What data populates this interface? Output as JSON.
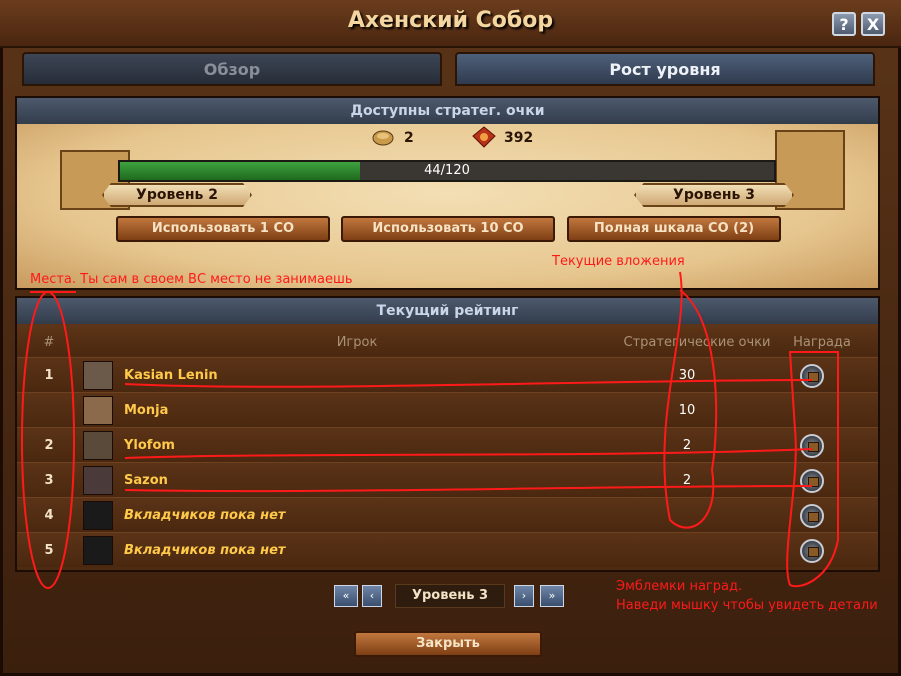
{
  "window": {
    "title": "Ахенский Собор",
    "help_label": "?",
    "close_label": "X"
  },
  "tabs": [
    {
      "label": "Обзор",
      "active": false
    },
    {
      "label": "Рост уровня",
      "active": true
    }
  ],
  "fp_section": {
    "header": "Доступны стратег. очки",
    "fp_count": "2",
    "goods_count": "392",
    "progress_text": "44/120",
    "progress_value": 0.367,
    "level_current": "Уровень 2",
    "level_next": "Уровень 3",
    "buttons": [
      "Использовать 1 СО",
      "Использовать 10 СО",
      "Полная шкала СО (2)"
    ]
  },
  "ranking": {
    "header": "Текущий рейтинг",
    "columns": {
      "rank": "#",
      "player": "Игрок",
      "points": "Стратегические очки",
      "reward": "Награда"
    },
    "rows": [
      {
        "rank": "1",
        "player": "Kasian Lenin",
        "points": "30",
        "reward": true,
        "avatar": "#6b5a4a"
      },
      {
        "rank": "",
        "player": "Monja",
        "points": "10",
        "reward": false,
        "avatar": "#8a6a4a"
      },
      {
        "rank": "2",
        "player": "Ylofom",
        "points": "2",
        "reward": true,
        "avatar": "#5a4a3a"
      },
      {
        "rank": "3",
        "player": "Sazon",
        "points": "2",
        "reward": true,
        "avatar": "#4a3a3a"
      },
      {
        "rank": "4",
        "player": "Вкладчиков пока нет",
        "points": "",
        "reward": true,
        "avatar": "#1a1a1a"
      },
      {
        "rank": "5",
        "player": "Вкладчиков пока нет",
        "points": "",
        "reward": true,
        "avatar": "#1a1a1a"
      }
    ]
  },
  "pager": {
    "level_label": "Уровень 3"
  },
  "close_button": "Закрыть",
  "annotations": {
    "places": "Места. Ты сам в своем ВС место не занимаешь",
    "investments": "Текущие вложения",
    "emblems_1": "Эмблемки наград.",
    "emblems_2": "Наведи мышку чтобы увидеть детали"
  },
  "colors": {
    "annotation": "#ff1a1a",
    "player_name": "#ffc94a",
    "progress": "#2e8b2e"
  }
}
